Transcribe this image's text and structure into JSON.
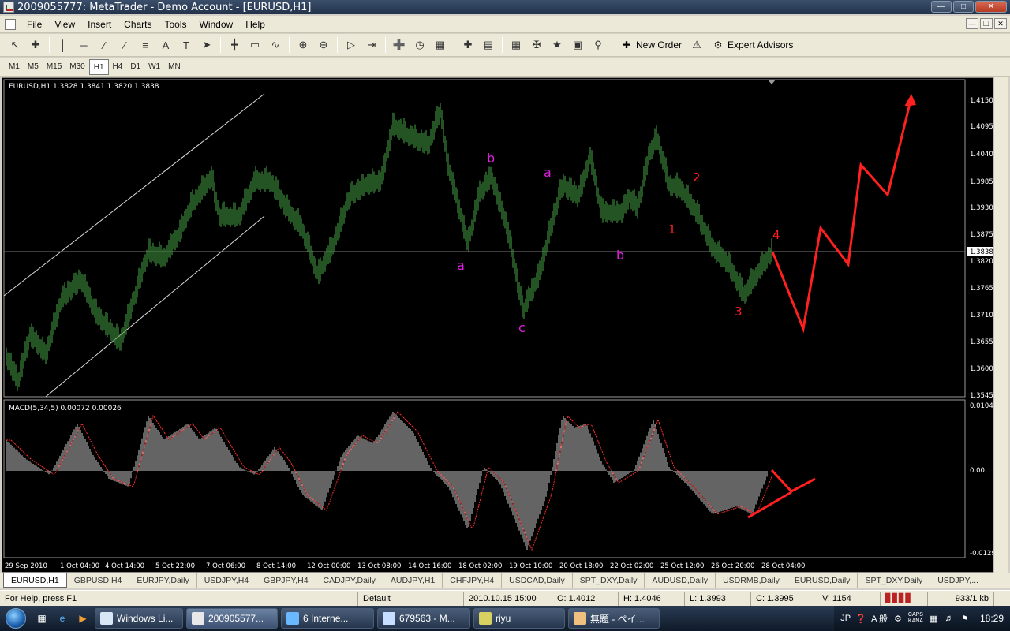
{
  "window": {
    "title": "2009055777: MetaTrader - Demo Account - [EURUSD,H1]"
  },
  "menu": [
    "File",
    "View",
    "Insert",
    "Charts",
    "Tools",
    "Window",
    "Help"
  ],
  "toolbar": {
    "new_order": "New Order",
    "expert_advisors": "Expert Advisors"
  },
  "timeframes": {
    "items": [
      "M1",
      "M5",
      "M15",
      "M30",
      "H1",
      "H4",
      "D1",
      "W1",
      "MN"
    ],
    "active": "H1"
  },
  "chart": {
    "header": "EURUSD,H1  1.3828 1.3841 1.3820 1.3838",
    "macd_header": "MACD(5,34,5) 0.00072 0.00026",
    "price_labels": [
      "1.4150",
      "1.4095",
      "1.4040",
      "1.3985",
      "1.3930",
      "1.3875",
      "1.3820",
      "1.3765",
      "1.3710",
      "1.3655",
      "1.3600",
      "1.3545"
    ],
    "current_price": "1.3838",
    "macd_labels": [
      "0.0104",
      "0.00",
      "-0.0129"
    ],
    "time_labels": [
      "29 Sep 2010",
      "1 Oct 04:00",
      "4 Oct 14:00",
      "5 Oct 22:00",
      "7 Oct 06:00",
      "8 Oct 14:00",
      "12 Oct 00:00",
      "13 Oct 08:00",
      "14 Oct 16:00",
      "18 Oct 02:00",
      "19 Oct 10:00",
      "20 Oct 18:00",
      "22 Oct 02:00",
      "25 Oct 12:00",
      "26 Oct 20:00",
      "28 Oct 04:00"
    ],
    "annotations": {
      "magenta": [
        "a",
        "b",
        "c",
        "a",
        "b"
      ],
      "red": [
        "1",
        "2",
        "3",
        "4"
      ]
    },
    "colors": {
      "candle": "#3c8c3c",
      "annot_magenta": "#e020e0",
      "annot_red": "#ff2020",
      "macd_signal": "#ff3030"
    }
  },
  "tabs": {
    "items": [
      "EURUSD,H1",
      "GBPUSD,H4",
      "EURJPY,Daily",
      "USDJPY,H4",
      "GBPJPY,H4",
      "CADJPY,Daily",
      "AUDJPY,H1",
      "CHFJPY,H4",
      "USDCAD,Daily",
      "SPT_DXY,Daily",
      "AUDUSD,Daily",
      "USDRMB,Daily",
      "EURUSD,Daily",
      "SPT_DXY,Daily",
      "USDJPY,..."
    ],
    "active": 0
  },
  "status": {
    "help": "For Help, press F1",
    "profile": "Default",
    "datetime": "2010.10.15 15:00",
    "open": "O: 1.4012",
    "high": "H: 1.4046",
    "low": "L: 1.3993",
    "close": "C: 1.3995",
    "volume": "V: 1154",
    "traffic": "933/1 kb"
  },
  "taskbar": {
    "tasks": [
      "Windows Li...",
      "200905577...",
      "6 Interne...",
      "679563 - M...",
      "riyu",
      "無題 - ペイ..."
    ],
    "tray": {
      "lang": "JP",
      "ime": "A 般",
      "caps": "CAPS",
      "kana": "KANA",
      "time": "18:29"
    }
  }
}
